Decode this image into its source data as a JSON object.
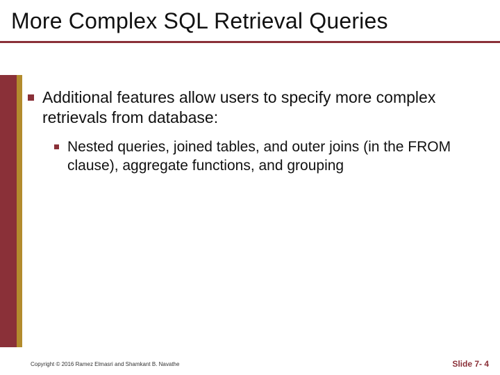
{
  "title": "More Complex SQL Retrieval Queries",
  "bullets": {
    "level1": "Additional features allow users to specify more complex retrievals from database:",
    "level2": "Nested queries, joined tables, and outer joins (in the FROM clause), aggregate functions, and grouping"
  },
  "footer": {
    "copyright": "Copyright © 2016 Ramez Elmasri and Shamkant B. Navathe",
    "slide_label": "Slide 7- 4"
  },
  "colors": {
    "accent_red": "#8a3038",
    "accent_gold": "#b38b2d"
  }
}
